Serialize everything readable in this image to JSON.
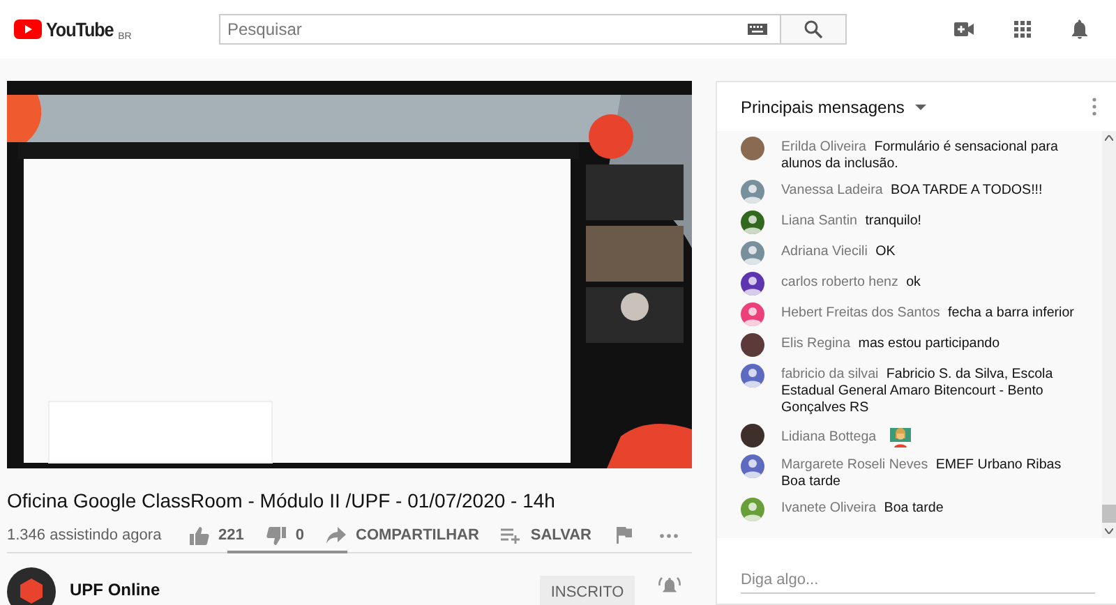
{
  "header": {
    "logo": {
      "text": "YouTube",
      "region": "BR"
    },
    "search": {
      "placeholder": "Pesquisar"
    }
  },
  "title": "Oficina Google ClassRoom - Módulo II /UPF - 01/07/2020 - 14h",
  "viewers": "1.346 assistindo agora",
  "actions": [
    {
      "kind": "like",
      "label": "221"
    },
    {
      "kind": "dislike",
      "label": "0"
    },
    {
      "kind": "share",
      "label": "COMPARTILHAR"
    },
    {
      "kind": "save",
      "label": "SALVAR"
    },
    {
      "kind": "report"
    },
    {
      "kind": "more"
    }
  ],
  "sentiment": {
    "level": 1
  },
  "channel": {
    "name": "UPF Online",
    "subscribe": {
      "label": "INSCRITO",
      "subscribed": true
    }
  },
  "chat": {
    "title": "Principais mensagens",
    "messages": [
      {
        "author": "Erilda Oliveira",
        "text": "Formulário é sensacional para alunos da inclusão.",
        "color": "#8a6a50"
      },
      {
        "author": "Vanessa Ladeira",
        "text": "BOA TARDE A TODOS!!!",
        "kind": "default",
        "color": "#78909c"
      },
      {
        "author": "Liana Santin",
        "text": "tranquilo!",
        "kind": "default",
        "color": "#33691e"
      },
      {
        "author": "Adriana Viecili",
        "text": "OK",
        "kind": "default",
        "color": "#78909c"
      },
      {
        "author": "carlos roberto henz",
        "text": "ok",
        "kind": "default",
        "color": "#5e35b1"
      },
      {
        "author": "Hebert Freitas dos Santos",
        "text": "fecha a barra inferior",
        "kind": "default",
        "color": "#ec407a"
      },
      {
        "author": "Elis Regina",
        "text": "mas estou participando",
        "color": "#5d3a3a"
      },
      {
        "author": "fabricio da silvai",
        "text": "Fabricio S. da Silva, Escola Estadual General Amaro Bitencourt - Bento Gonçalves RS",
        "kind": "default",
        "color": "#5c6bc0"
      },
      {
        "author": "Lidiana Bottega",
        "emoji": true,
        "color": "#3e2f2a"
      },
      {
        "author": "Margarete Roseli Neves",
        "text": "EMEF Urbano Ribas Boa tarde",
        "kind": "default",
        "color": "#5c6bc0"
      },
      {
        "author": "Ivanete Oliveira",
        "text": "Boa tarde",
        "kind": "default",
        "color": "#689f38"
      }
    ],
    "input": {
      "placeholder": "Diga algo..."
    }
  }
}
